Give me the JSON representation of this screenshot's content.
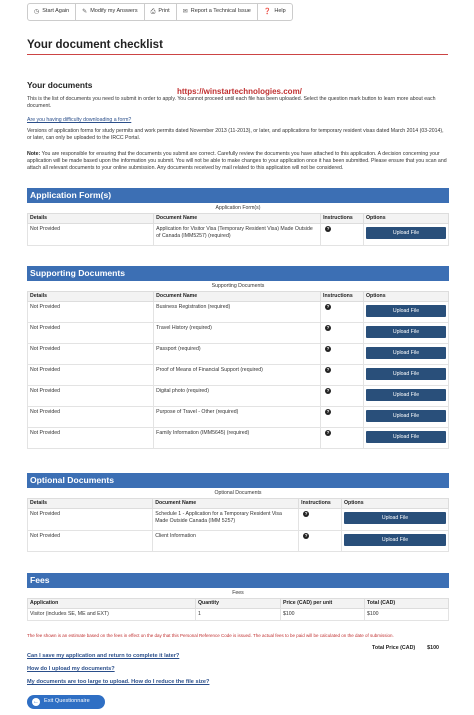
{
  "toolbar": {
    "start_again": "Start Again",
    "modify": "Modify my Answers",
    "print": "Print",
    "report": "Report a Technical Issue",
    "help": "Help"
  },
  "page_title": "Your document checklist",
  "your_documents": {
    "heading": "Your documents",
    "intro": "This is the list of documents you need to submit in order to apply. You cannot proceed until each file has been uploaded. Select the question mark button to learn more about each document.",
    "difficulty_link": "Are you having difficulty downloading a form?",
    "versions": "Versions of application forms for study permits and work permits dated November 2013 (11-2013), or later, and applications for temporary resident visas dated March 2014 (03-2014), or later, can only be uploaded to the IRCC Portal.",
    "note_label": "Note:",
    "note": "You are responsible for ensuring that the documents you submit are correct. Carefully review the documents you have attached to this application. A decision concerning your application will be made based upon the information you submit. You will not be able to make changes to your application once it has been submitted. Please ensure that you scan and attach all relevant documents to your online submission. Any documents received by mail related to this application will not be considered."
  },
  "watermark": "https://winstartechnologies.com/",
  "columns": {
    "details": "Details",
    "document_name": "Document Name",
    "instructions": "Instructions",
    "options": "Options"
  },
  "upload_label": "Upload File",
  "application_forms": {
    "title": "Application Form(s)",
    "caption": "Application Form(s)",
    "rows": [
      {
        "details": "Not Provided",
        "name": "Application for Visitor Visa (Temporary Resident Visa) Made Outside of Canada (IMM5257)  (required)"
      }
    ]
  },
  "supporting": {
    "title": "Supporting Documents",
    "caption": "Supporting Documents",
    "rows": [
      {
        "details": "Not Provided",
        "name": "Business Registration  (required)"
      },
      {
        "details": "Not Provided",
        "name": "Travel History  (required)"
      },
      {
        "details": "Not Provided",
        "name": "Passport  (required)"
      },
      {
        "details": "Not Provided",
        "name": "Proof of Means of Financial Support  (required)"
      },
      {
        "details": "Not Provided",
        "name": "Digital photo  (required)"
      },
      {
        "details": "Not Provided",
        "name": "Purpose of Travel - Other  (required)"
      },
      {
        "details": "Not Provided",
        "name": "Family Information (IMM5645)  (required)"
      }
    ]
  },
  "optional": {
    "title": "Optional Documents",
    "caption": "Optional Documents",
    "rows": [
      {
        "details": "Not Provided",
        "name": "Schedule 1 - Application for a Temporary Resident Visa Made Outside Canada (IMM 5257)"
      },
      {
        "details": "Not Provided",
        "name": "Client Information"
      }
    ]
  },
  "fees": {
    "title": "Fees",
    "caption": "Fees",
    "columns": {
      "application": "Application",
      "quantity": "Quantity",
      "price": "Price (CAD) per unit",
      "total": "Total (CAD)"
    },
    "rows": [
      {
        "application": "Visitor (includes SE, ME and EXT)",
        "quantity": "1",
        "price": "$100",
        "total": "$100"
      }
    ],
    "note": "The fee shown is an estimate based on the fees in effect on the day that this Personal Reference Code is issued. The actual fees to be paid will be calculated on the date of submission.",
    "total_label": "Total Price (CAD)",
    "total_value": "$100"
  },
  "links": {
    "save": "Can I save my application and return to complete it later?",
    "upload": "How do I upload my documents?",
    "too_large": "My documents are too large to upload. How do I reduce the file size?"
  },
  "exit_label": "Exit Questionnaire"
}
